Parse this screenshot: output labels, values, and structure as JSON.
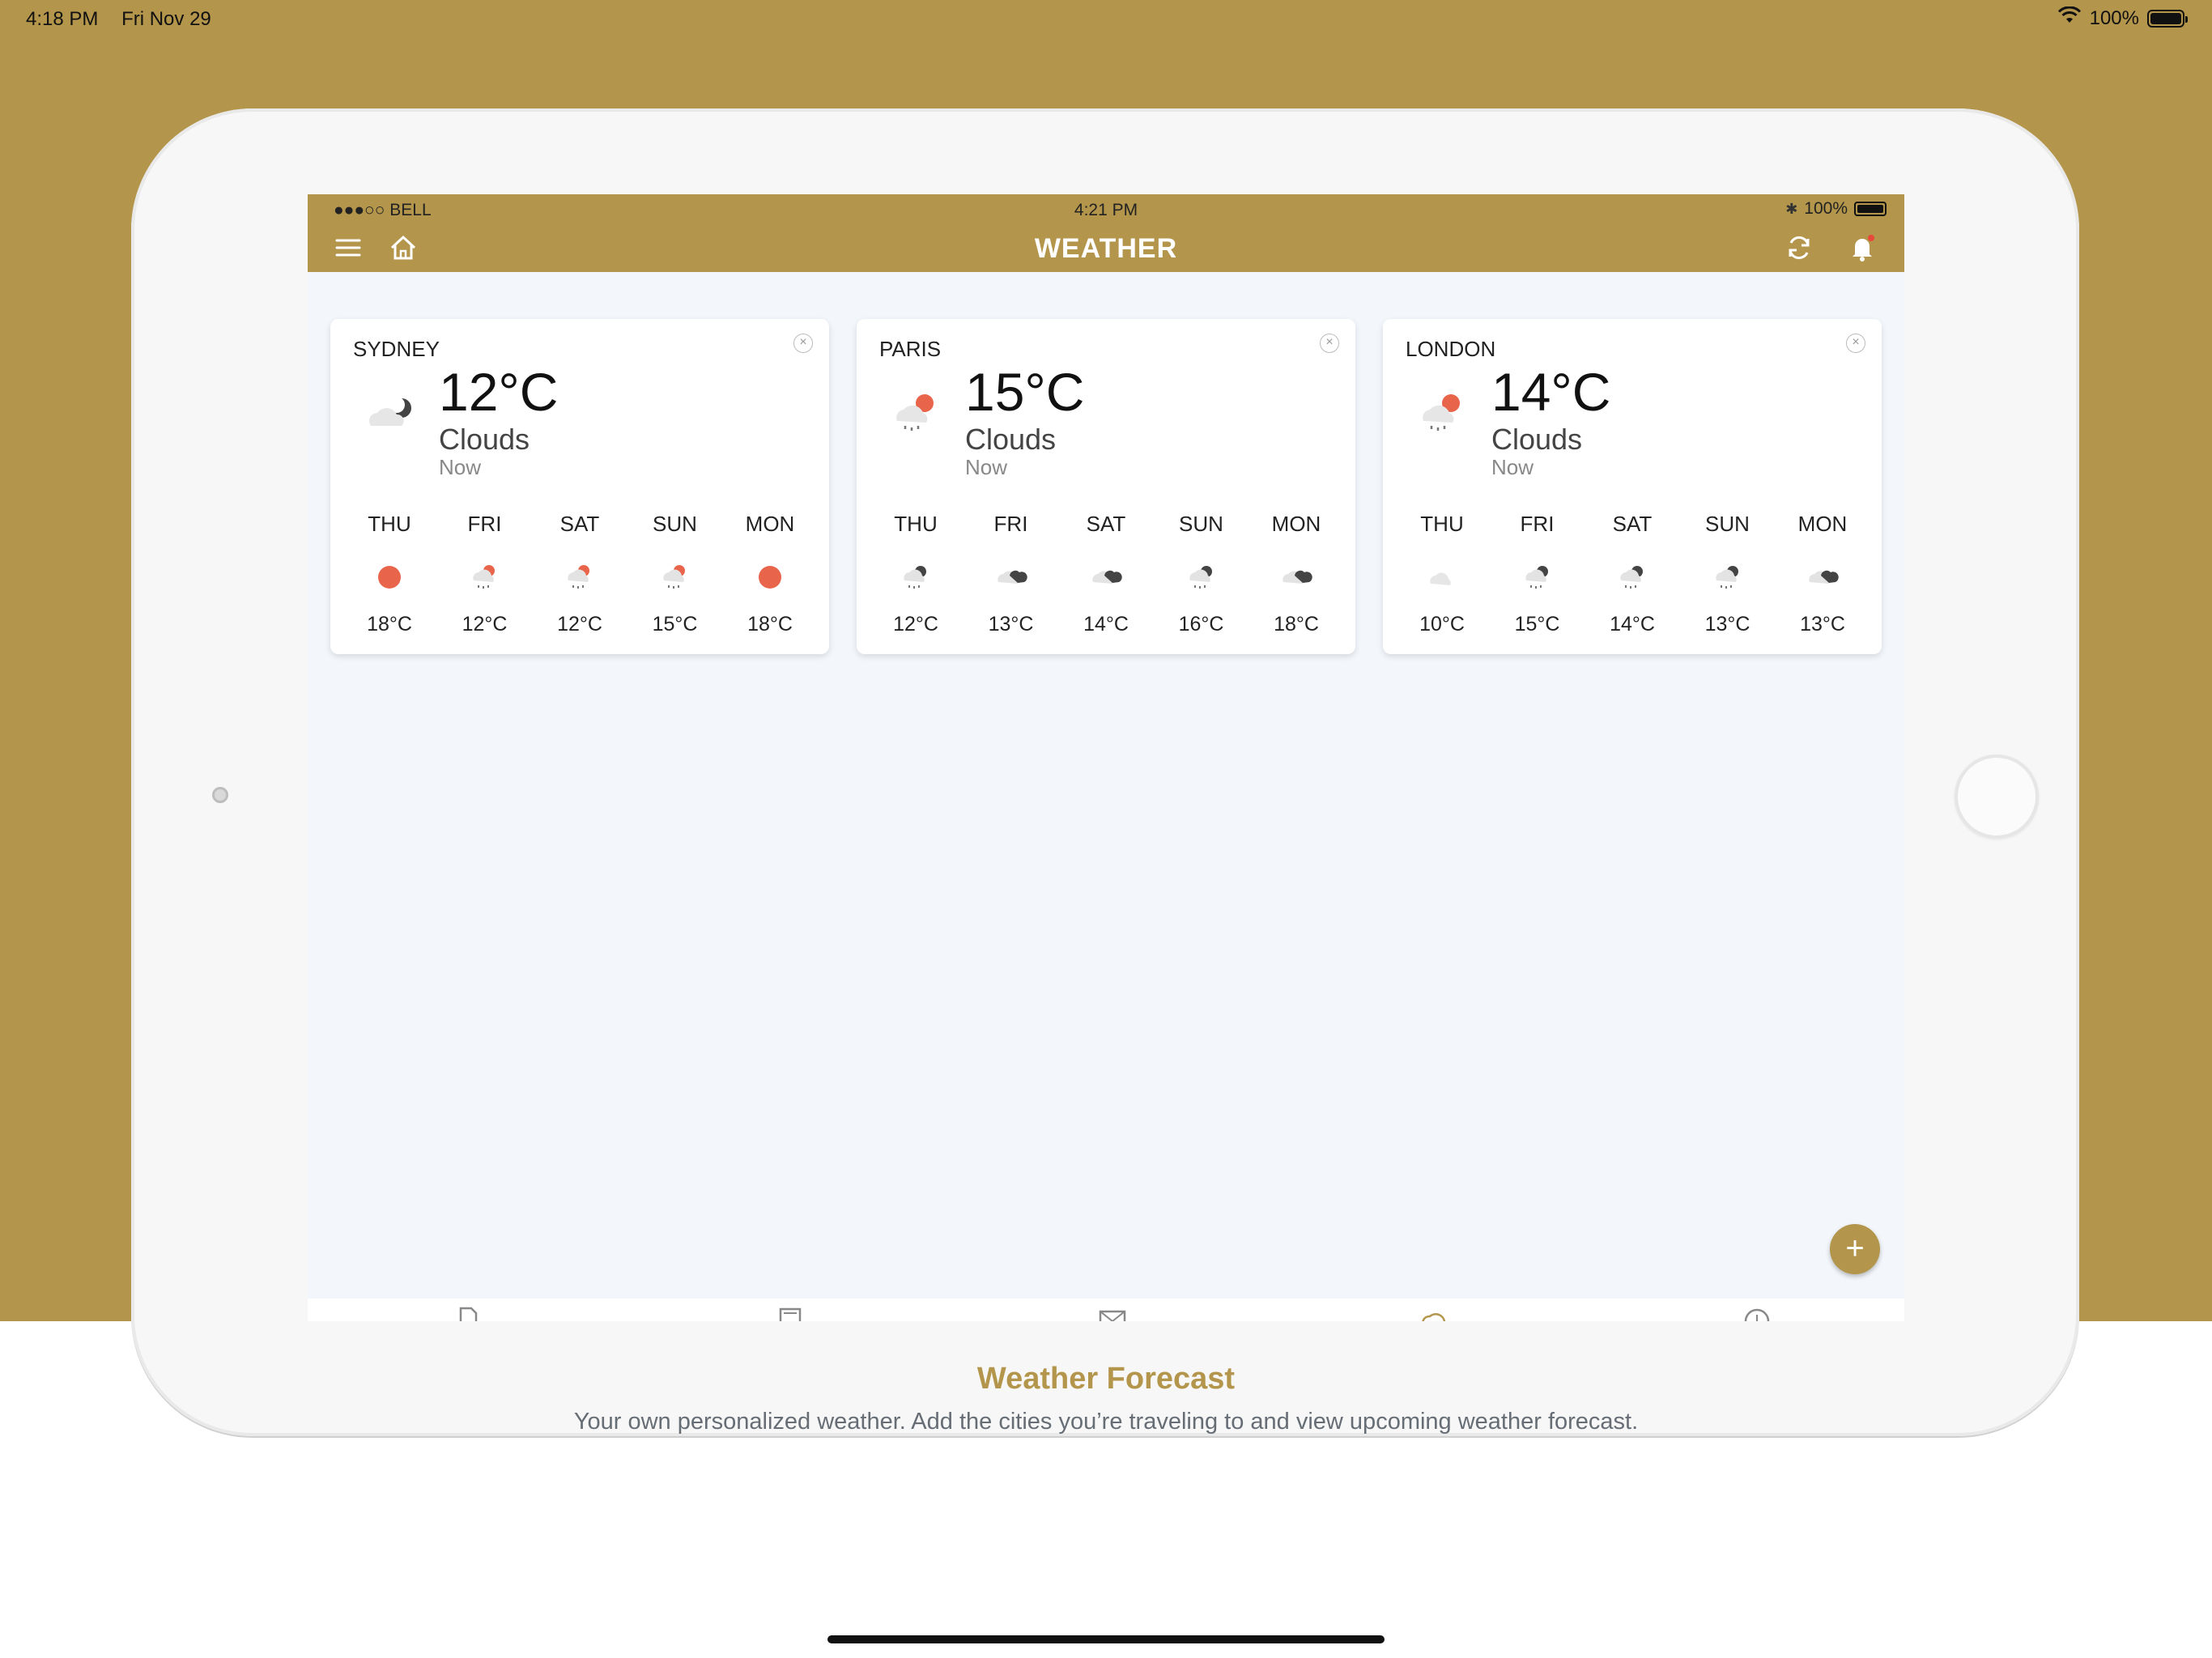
{
  "system_status": {
    "time": "4:18 PM",
    "date": "Fri Nov 29",
    "battery": "100%"
  },
  "app": {
    "carrier": "●●●○○ BELL",
    "time": "4:21 PM",
    "battery": "100%",
    "title": "WEATHER"
  },
  "cards": [
    {
      "city": "SYDNEY",
      "temp": "12°C",
      "description": "Clouds",
      "time": "Now",
      "main_icon": "cloud-moon",
      "forecast": [
        {
          "day": "THU",
          "icon": "sun",
          "temp": "18°C"
        },
        {
          "day": "FRI",
          "icon": "rain-sun",
          "temp": "12°C"
        },
        {
          "day": "SAT",
          "icon": "rain-sun",
          "temp": "12°C"
        },
        {
          "day": "SUN",
          "icon": "rain-sun",
          "temp": "15°C"
        },
        {
          "day": "MON",
          "icon": "sun",
          "temp": "18°C"
        }
      ]
    },
    {
      "city": "PARIS",
      "temp": "15°C",
      "description": "Clouds",
      "time": "Now",
      "main_icon": "rain-sun",
      "forecast": [
        {
          "day": "THU",
          "icon": "rain-night",
          "temp": "12°C"
        },
        {
          "day": "FRI",
          "icon": "cloud-night",
          "temp": "13°C"
        },
        {
          "day": "SAT",
          "icon": "cloud-night",
          "temp": "14°C"
        },
        {
          "day": "SUN",
          "icon": "rain-night",
          "temp": "16°C"
        },
        {
          "day": "MON",
          "icon": "cloud-night",
          "temp": "18°C"
        }
      ]
    },
    {
      "city": "LONDON",
      "temp": "14°C",
      "description": "Clouds",
      "time": "Now",
      "main_icon": "rain-sun",
      "forecast": [
        {
          "day": "THU",
          "icon": "cloud",
          "temp": "10°C"
        },
        {
          "day": "FRI",
          "icon": "rain-night",
          "temp": "15°C"
        },
        {
          "day": "SAT",
          "icon": "rain-night",
          "temp": "14°C"
        },
        {
          "day": "SUN",
          "icon": "rain-night",
          "temp": "13°C"
        },
        {
          "day": "MON",
          "icon": "cloud-night",
          "temp": "13°C"
        }
      ]
    }
  ],
  "caption": {
    "title": "Weather Forecast",
    "subtitle": "Your own personalized weather. Add the cities you’re traveling to and view upcoming weather forecast."
  },
  "colors": {
    "brand": "#b3954b",
    "sun": "#e8644a",
    "background": "#f3f7fb"
  },
  "icons": {
    "menu": "menu-icon",
    "home": "home-icon",
    "refresh": "refresh-icon",
    "bell": "bell-icon",
    "add": "plus-icon",
    "close": "close-icon"
  },
  "fab_label": "+",
  "close_label": "×"
}
